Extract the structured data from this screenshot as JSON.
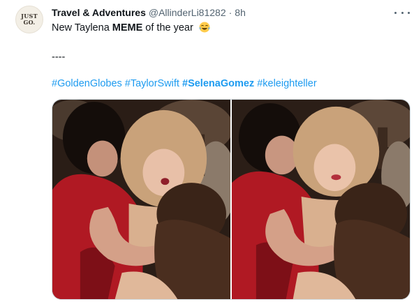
{
  "tweet": {
    "author": {
      "display_name": "Travel & Adventures",
      "handle": "@AllinderLi81282",
      "avatar_text": [
        "JUST",
        "GO."
      ]
    },
    "separator": "·",
    "time": "8h",
    "text": {
      "line1_prefix": "New Taylena ",
      "line1_bold": "MEME",
      "line1_suffix": " of the year",
      "line1_emoji": "face-with-tears-of-joy-emoji",
      "line2": "----",
      "hashtags": [
        "#GoldenGlobes",
        "#TaylorSwift",
        "#SelenaGomez",
        "#keleighteller"
      ]
    },
    "media": {
      "photos": [
        "photo-left",
        "photo-right"
      ]
    }
  },
  "colors": {
    "link": "#1d9bf0",
    "secondary_text": "#536471",
    "primary_text": "#0f1419",
    "dress_red": "#b01923"
  }
}
